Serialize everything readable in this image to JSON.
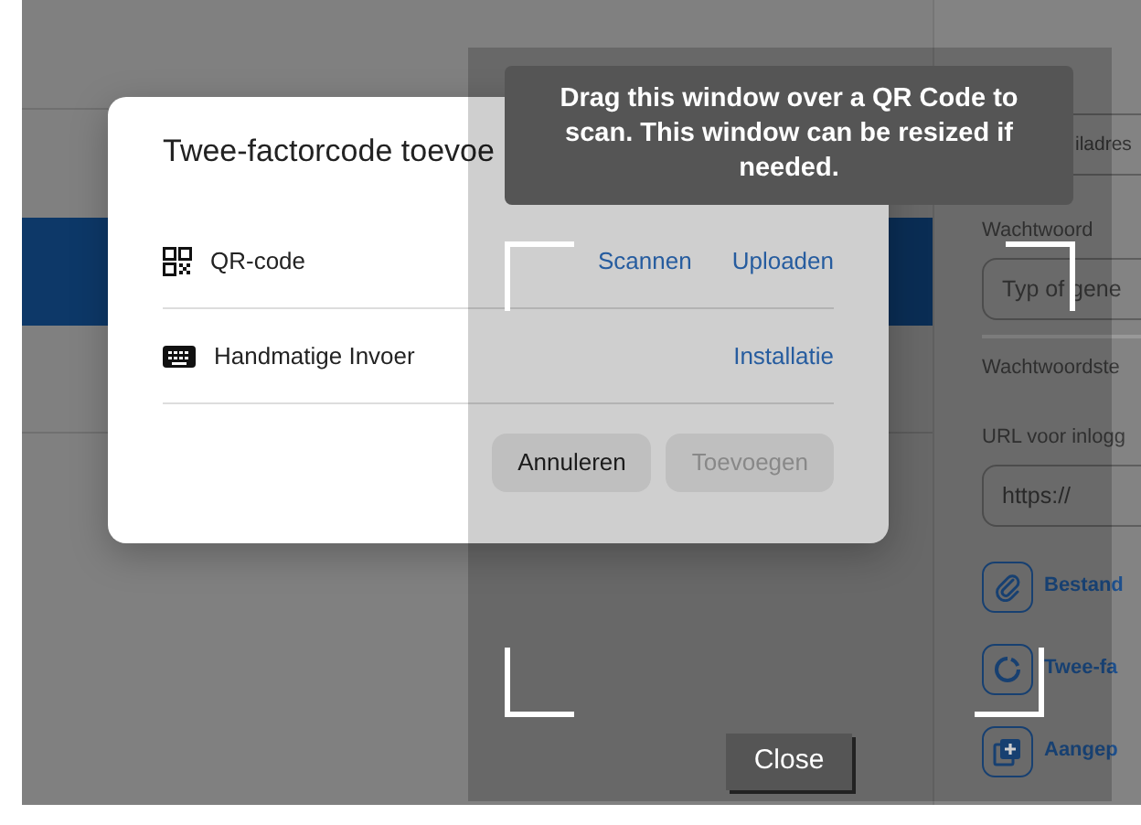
{
  "background_list": {
    "rows": [
      {
        "selected": false
      },
      {
        "selected": true
      },
      {
        "selected": false
      }
    ]
  },
  "background_form": {
    "email_field": {
      "value": "iladres"
    },
    "password_label": "Wachtwoord",
    "password_field": {
      "placeholder": "Typ of gene"
    },
    "strength_label": "Wachtwoordste",
    "url_label": "URL voor inlogg",
    "url_field": {
      "value": "https://"
    },
    "actions": [
      {
        "kind": "attachment",
        "label": "Bestand"
      },
      {
        "kind": "twofactor",
        "label": "Twee-fa"
      },
      {
        "kind": "custom",
        "label": "Aangep"
      }
    ]
  },
  "dialog": {
    "title": "Twee-factorcode toevoe",
    "options": [
      {
        "kind": "qr",
        "label": "QR-code",
        "links": [
          "Scannen",
          "Uploaden"
        ]
      },
      {
        "kind": "manual",
        "label": "Handmatige Invoer",
        "links": [
          "Installatie"
        ]
      }
    ],
    "buttons": [
      {
        "label": "Annuleren",
        "disabled": false
      },
      {
        "label": "Toevoegen",
        "disabled": true
      }
    ]
  },
  "scanner": {
    "hint": "Drag this window over a QR Code to scan. This window can be resized if needed.",
    "close": "Close"
  }
}
